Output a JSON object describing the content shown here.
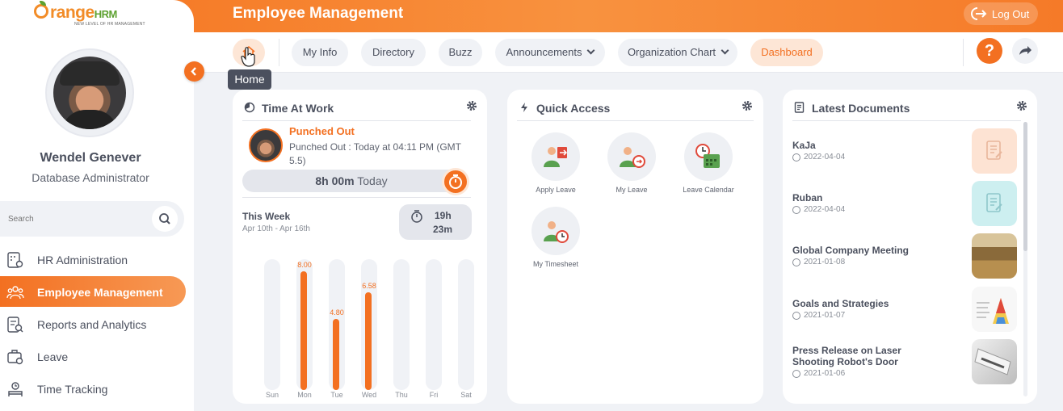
{
  "app": {
    "logo_word": "range",
    "logo_hrm": "HRM",
    "logo_tagline": "NEW LEVEL OF HR MANAGEMENT",
    "page_title": "Employee Management",
    "logout_label": "Log Out",
    "accent": "#f37021"
  },
  "user": {
    "name": "Wendel Genever",
    "role": "Database Administrator"
  },
  "search": {
    "placeholder": "Search"
  },
  "sidebar": {
    "items": [
      {
        "label": "HR Administration",
        "icon": "hr-admin-icon",
        "active": false
      },
      {
        "label": "Employee Management",
        "icon": "employees-icon",
        "active": true
      },
      {
        "label": "Reports and Analytics",
        "icon": "reports-icon",
        "active": false
      },
      {
        "label": "Leave",
        "icon": "leave-icon",
        "active": false
      },
      {
        "label": "Time Tracking",
        "icon": "time-icon",
        "active": false
      }
    ]
  },
  "nav": {
    "home_tooltip": "Home",
    "items": [
      "My Info",
      "Directory",
      "Buzz",
      "Announcements",
      "Organization Chart",
      "Dashboard"
    ],
    "active": "Dashboard",
    "help": "?"
  },
  "time_at_work": {
    "title": "Time At Work",
    "status": "Punched Out",
    "detail": "Punched Out : Today at 04:11 PM (GMT 5.5)",
    "today_hours": "8h 00m",
    "today_label": "Today",
    "week_title": "This Week",
    "week_range": "Apr 10th - Apr 16th",
    "week_hours": "19h",
    "week_minutes": "23m",
    "days": [
      {
        "day": "Sun",
        "hours": 0,
        "label": ""
      },
      {
        "day": "Mon",
        "hours": 8.0,
        "label": "8.00"
      },
      {
        "day": "Tue",
        "hours": 4.8,
        "label": "4.80"
      },
      {
        "day": "Wed",
        "hours": 6.58,
        "label": "6.58"
      },
      {
        "day": "Thu",
        "hours": 0,
        "label": ""
      },
      {
        "day": "Fri",
        "hours": 0,
        "label": ""
      },
      {
        "day": "Sat",
        "hours": 0,
        "label": ""
      }
    ],
    "max_hours": 8.5
  },
  "quick_access": {
    "title": "Quick Access",
    "items": [
      "Apply Leave",
      "My Leave",
      "Leave Calendar",
      "My Timesheet"
    ]
  },
  "latest_documents": {
    "title": "Latest Documents",
    "docs": [
      {
        "title": "KaJa",
        "date": "2022-04-04",
        "thumb_color": "#fde3d3"
      },
      {
        "title": "Ruban",
        "date": "2022-04-04",
        "thumb_color": "#cdeff0"
      },
      {
        "title": "Global Company Meeting",
        "date": "2021-01-08",
        "thumb_color": "#b78f4f"
      },
      {
        "title": "Goals and Strategies",
        "date": "2021-01-07",
        "thumb_color": "#f3f3f3"
      },
      {
        "title": "Press Release on Laser Shooting Robot's Door",
        "date": "2021-01-06",
        "thumb_color": "#d9d9d9"
      }
    ]
  }
}
